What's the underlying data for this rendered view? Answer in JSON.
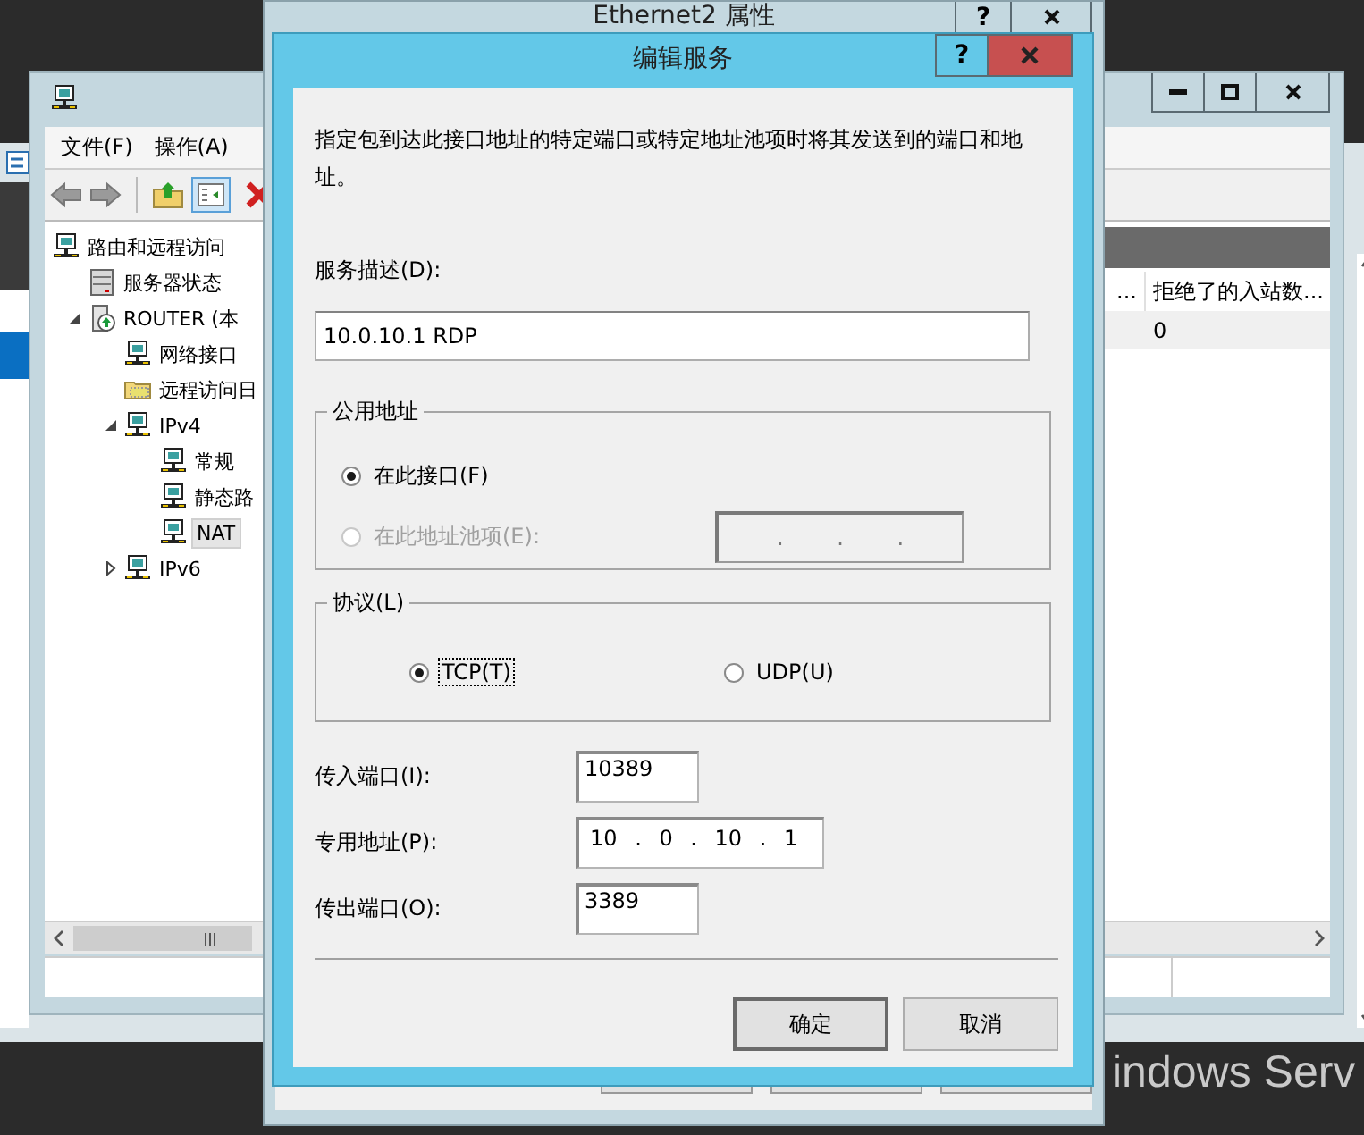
{
  "desktop": {
    "wallpaper_text": "indows Serv"
  },
  "mmc": {
    "menu": [
      "文件(F)",
      "操作(A)"
    ],
    "tree": [
      {
        "label": "路由和远程访问",
        "kind": "network",
        "selected": false,
        "children": [
          {
            "label": "服务器状态",
            "kind": "server",
            "selected": false
          },
          {
            "label": "ROUTER (本",
            "kind": "router",
            "selected": false,
            "expanded": true,
            "children": [
              {
                "label": "网络接口",
                "kind": "network",
                "selected": false
              },
              {
                "label": "远程访问日",
                "kind": "folder",
                "selected": false
              },
              {
                "label": "IPv4",
                "kind": "network",
                "selected": false,
                "expanded": true,
                "children": [
                  {
                    "label": "常规",
                    "kind": "network",
                    "selected": false
                  },
                  {
                    "label": "静态路",
                    "kind": "network",
                    "selected": false
                  },
                  {
                    "label": "NAT",
                    "kind": "network",
                    "selected": true
                  }
                ]
              },
              {
                "label": "IPv6",
                "kind": "network",
                "selected": false,
                "expanded": false
              }
            ]
          }
        ]
      }
    ],
    "columns": [
      "...",
      "拒绝了的入站数..."
    ],
    "rows": [
      {
        "column_2": "0"
      }
    ]
  },
  "properties": {
    "title": "Ethernet2 属性",
    "help": "?"
  },
  "edit": {
    "title": "编辑服务",
    "help": "?",
    "intro": "指定包到达此接口地址的特定端口或特定地址池项时将其发送到的端口和地址。",
    "description_label": "服务描述(D):",
    "description": "10.0.10.1 RDP",
    "public_group": "公用地址",
    "public_options": [
      {
        "label": "在此接口(F)",
        "selected": true,
        "disabled": false
      },
      {
        "label": "在此地址池项(E):",
        "selected": false,
        "disabled": true,
        "address": ". . ."
      }
    ],
    "protocol_group": "协议(L)",
    "protocols": [
      {
        "label": "TCP(T)",
        "selected": true,
        "focused": true
      },
      {
        "label": "UDP(U)",
        "selected": false,
        "focused": false
      }
    ],
    "fields": [
      {
        "label": "传入端口(I):",
        "value": "10389",
        "kind": "port"
      },
      {
        "label": "专用地址(P):",
        "value": "10 . 0 . 10 . 1",
        "kind": "ip"
      },
      {
        "label": "传出端口(O):",
        "value": "3389",
        "kind": "port"
      }
    ],
    "buttons": [
      {
        "label": "确定",
        "default": true
      },
      {
        "label": "取消",
        "default": false
      }
    ]
  }
}
